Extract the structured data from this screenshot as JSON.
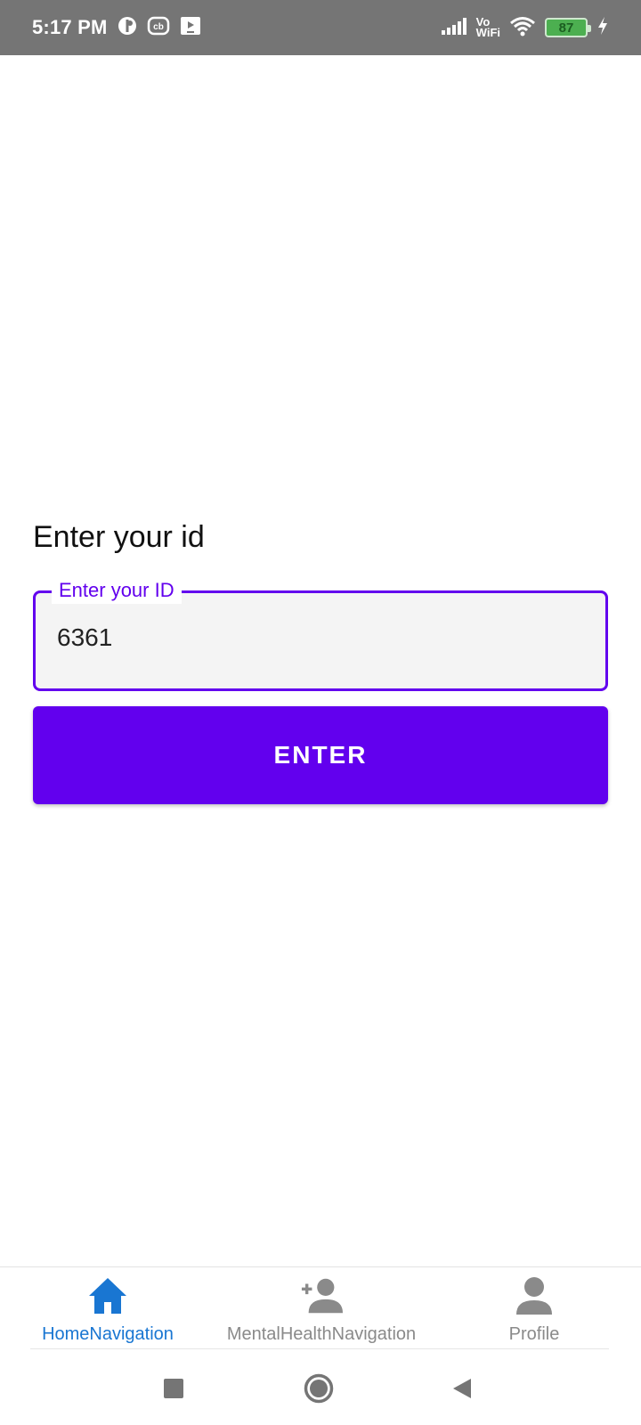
{
  "status_bar": {
    "time": "5:17 PM",
    "vo": "Vo",
    "wifi_text": "WiFi",
    "battery": "87",
    "icons": [
      "app-icon",
      "cb-icon",
      "media-icon",
      "signal-icon",
      "wifi-icon",
      "battery-icon",
      "charging-icon"
    ]
  },
  "main": {
    "heading": "Enter your id",
    "id_field": {
      "label": "Enter your ID",
      "value": "6361"
    },
    "enter_button": "ENTER"
  },
  "bottom_nav": {
    "items": [
      {
        "label": "HomeNavigation",
        "icon": "home-icon",
        "active": true
      },
      {
        "label": "MentalHealthNavigation",
        "icon": "add-person-icon",
        "active": false
      },
      {
        "label": "Profile",
        "icon": "person-icon",
        "active": false
      }
    ]
  },
  "colors": {
    "primary": "#6200ee",
    "active_nav": "#1976d2",
    "inactive_nav": "#8a8a8a",
    "status_bar": "#757575"
  }
}
